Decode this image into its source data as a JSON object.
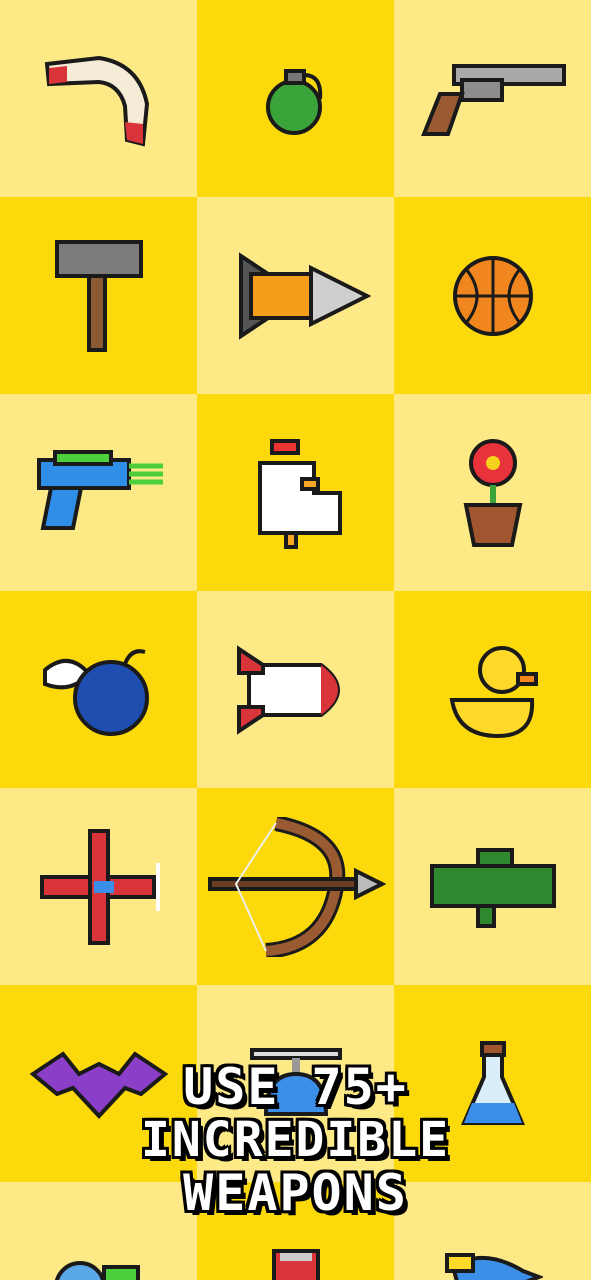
{
  "colors": {
    "light": "#fde986",
    "dark": "#fcd90a"
  },
  "weapons": [
    {
      "name": "boomerang-icon"
    },
    {
      "name": "grenade-icon"
    },
    {
      "name": "revolver-icon"
    },
    {
      "name": "hammer-icon"
    },
    {
      "name": "drill-rocket-icon"
    },
    {
      "name": "basketball-icon"
    },
    {
      "name": "ray-gun-icon"
    },
    {
      "name": "chicken-icon"
    },
    {
      "name": "potted-flower-icon"
    },
    {
      "name": "winged-bomb-icon"
    },
    {
      "name": "rocket-icon"
    },
    {
      "name": "rubber-duck-icon"
    },
    {
      "name": "airplane-icon"
    },
    {
      "name": "crossbow-icon"
    },
    {
      "name": "bazooka-icon"
    },
    {
      "name": "bat-icon"
    },
    {
      "name": "propeller-hat-icon"
    },
    {
      "name": "potion-flask-icon"
    },
    {
      "name": "snail-icon"
    },
    {
      "name": "soda-can-icon"
    },
    {
      "name": "blue-bird-icon"
    }
  ],
  "caption": {
    "line1": "USE 75+",
    "line2": "INCREDIBLE",
    "line3": "WEAPONS"
  }
}
